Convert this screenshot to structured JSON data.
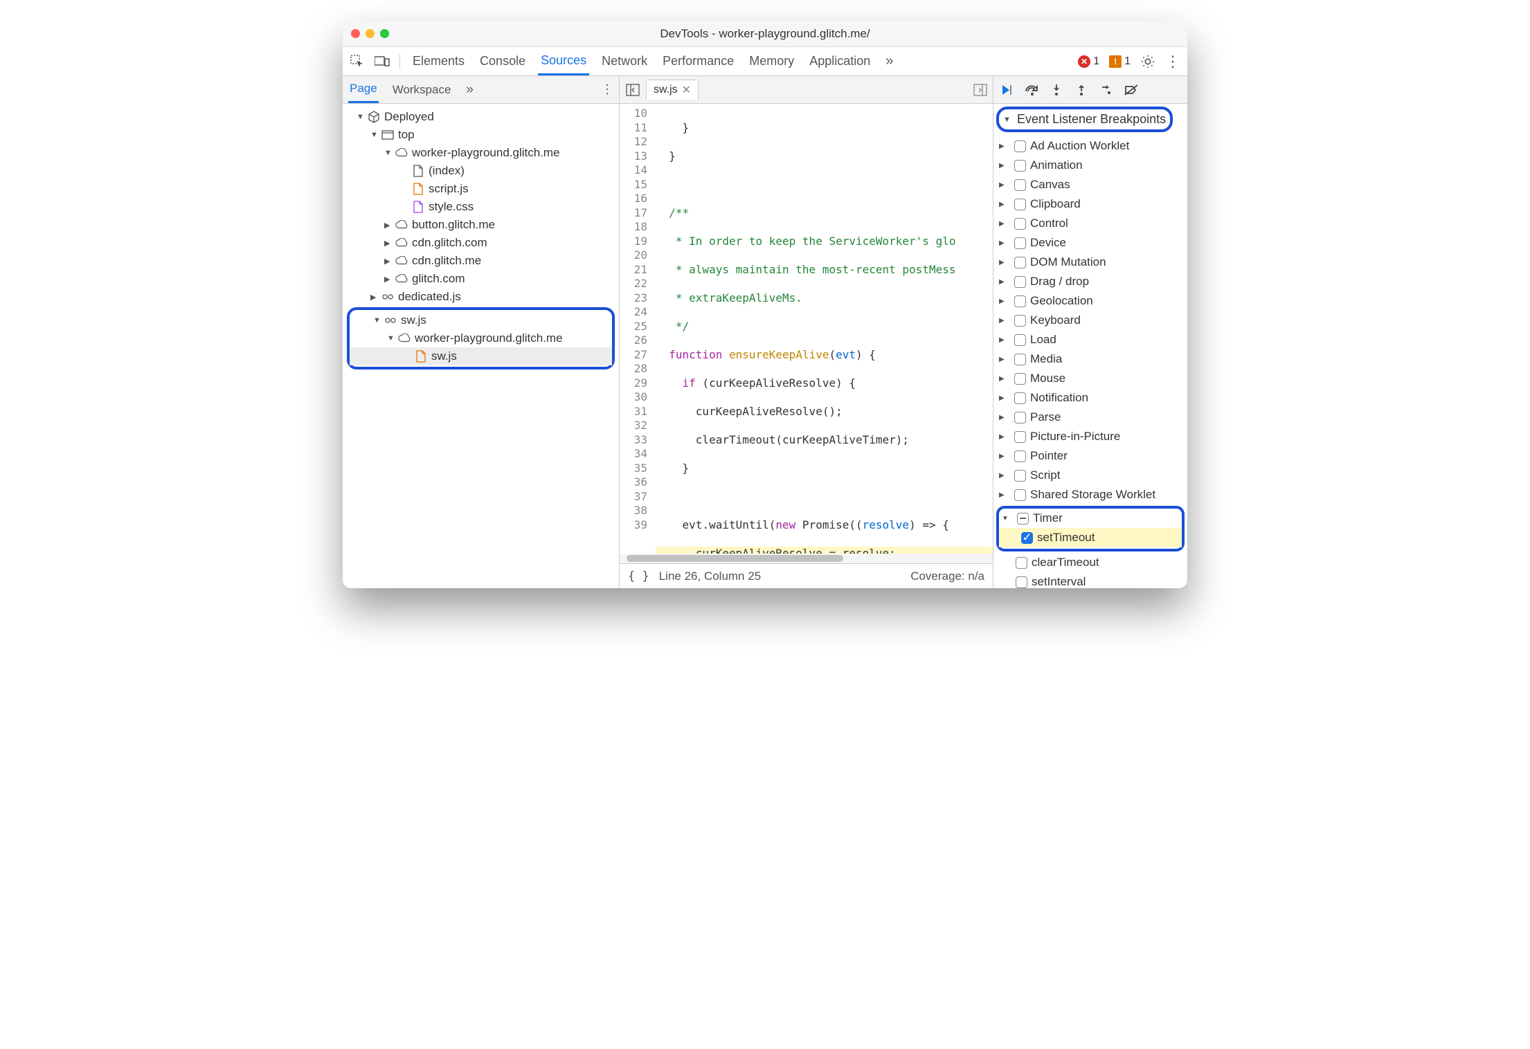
{
  "window": {
    "title": "DevTools - worker-playground.glitch.me/"
  },
  "toolbar": {
    "tabs": [
      "Elements",
      "Console",
      "Sources",
      "Network",
      "Performance",
      "Memory",
      "Application"
    ],
    "active": "Sources",
    "overflow_label": "»",
    "error_count": "1",
    "warning_count": "1"
  },
  "left": {
    "tabs": {
      "page": "Page",
      "workspace": "Workspace",
      "overflow": "»"
    },
    "tree": {
      "deployed": "Deployed",
      "top": "top",
      "origin1": "worker-playground.glitch.me",
      "index": "(index)",
      "scriptjs": "script.js",
      "stylecss": "style.css",
      "button": "button.glitch.me",
      "cdn_com": "cdn.glitch.com",
      "cdn_me": "cdn.glitch.me",
      "glitch": "glitch.com",
      "dedicated": "dedicated.js",
      "swjs": "sw.js",
      "origin2": "worker-playground.glitch.me",
      "swjs_file": "sw.js"
    }
  },
  "editor": {
    "filename": "sw.js",
    "lines": {
      "l10": "    }",
      "l11": "  }",
      "l12": "",
      "l13": "  /**",
      "l14": "   * In order to keep the ServiceWorker's glo",
      "l15": "   * always maintain the most-recent postMess",
      "l16": "   * extraKeepAliveMs.",
      "l17": "   */",
      "l24b": "    evt.waitUntil(",
      "l25": "      curKeepAliveResolve = resolve;",
      "l27": "    }));",
      "l28": "",
      "l29": "  }",
      "l30": "",
      "l33": "",
      "l39": "      }"
    },
    "status_line": "Line 26, Column 25",
    "coverage": "Coverage: n/a"
  },
  "breakpoints": {
    "header": "Event Listener Breakpoints",
    "categories": [
      "Ad Auction Worklet",
      "Animation",
      "Canvas",
      "Clipboard",
      "Control",
      "Device",
      "DOM Mutation",
      "Drag / drop",
      "Geolocation",
      "Keyboard",
      "Load",
      "Media",
      "Mouse",
      "Notification",
      "Parse",
      "Picture-in-Picture",
      "Pointer",
      "Script",
      "Shared Storage Worklet"
    ],
    "timer": {
      "label": "Timer",
      "setTimeout": "setTimeout",
      "clearTimeout": "clearTimeout",
      "setInterval": "setInterval"
    }
  }
}
